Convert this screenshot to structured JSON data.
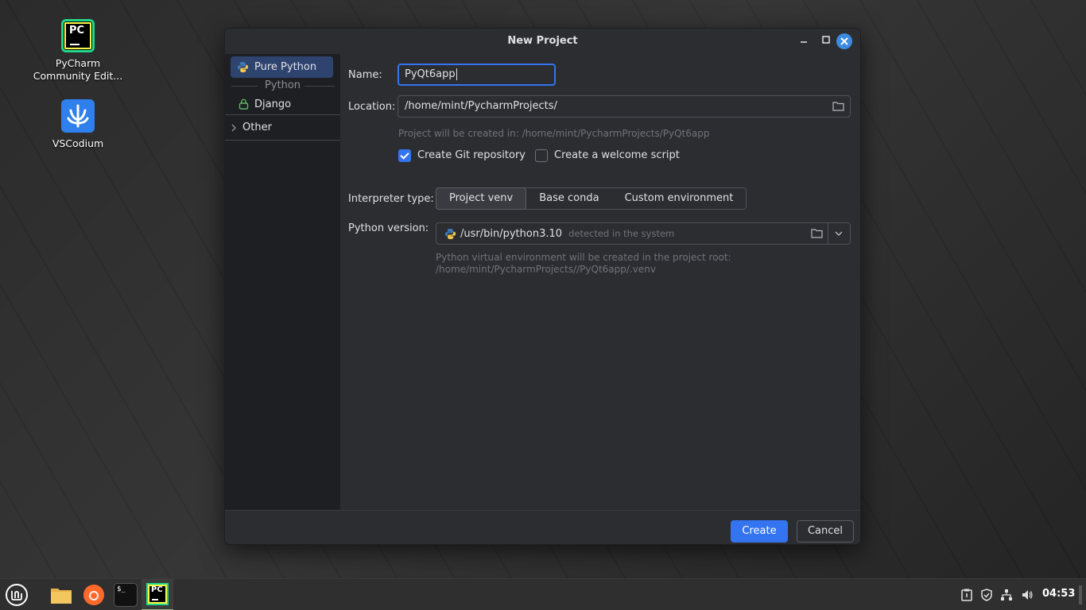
{
  "desktop": {
    "icons": [
      {
        "label": "PyCharm Community Edit...",
        "name": "pycharm",
        "logo_text": "PC"
      },
      {
        "label": "VSCodium",
        "name": "vscodium"
      }
    ]
  },
  "dialog": {
    "title": "New Project",
    "sidebar": {
      "items": [
        {
          "label": "Pure Python",
          "selected": true
        },
        {
          "label": "Django",
          "selected": false
        }
      ],
      "group_label": "Python",
      "other_label": "Other"
    },
    "form": {
      "name_label": "Name:",
      "name_value": "PyQt6app",
      "location_label": "Location:",
      "location_value": "/home/mint/PycharmProjects/",
      "project_hint": "Project will be created in: /home/mint/PycharmProjects/PyQt6app",
      "create_git_label": "Create Git repository",
      "create_git_checked": true,
      "welcome_script_label": "Create a welcome script",
      "welcome_script_checked": false,
      "interpreter_type_label": "Interpreter type:",
      "interpreter_types": [
        "Project venv",
        "Base conda",
        "Custom environment"
      ],
      "interpreter_selected": "Project venv",
      "python_version_label": "Python version:",
      "python_version_value": "/usr/bin/python3.10",
      "python_version_note": "detected in the system",
      "venv_hint_line1": "Python virtual environment will be created in the project root:",
      "venv_hint_line2": "/home/mint/PycharmProjects//PyQt6app/.venv"
    },
    "buttons": {
      "create": "Create",
      "cancel": "Cancel"
    }
  },
  "taskbar": {
    "clock": "04:53",
    "pinned": [
      "menu",
      "files",
      "firefox",
      "terminal",
      "pycharm"
    ],
    "terminal_glyph": "$_"
  },
  "colors": {
    "accent": "#3574f0",
    "dialog_bg": "#2b2d30",
    "sidebar_selected": "#2e436e"
  }
}
